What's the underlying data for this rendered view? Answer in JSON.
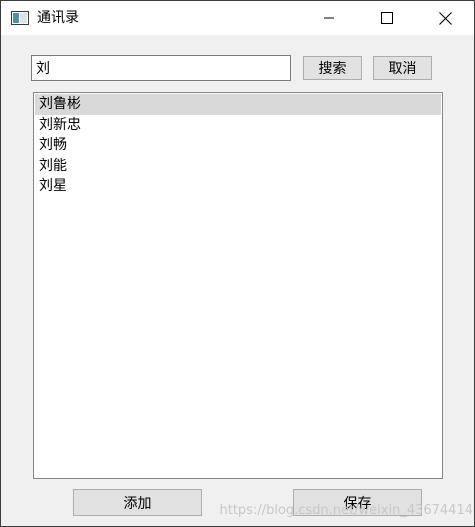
{
  "window": {
    "title": "通讯录",
    "icons": {
      "app": "app-window-icon",
      "minimize": "minimize-icon",
      "maximize": "maximize-icon",
      "close": "close-icon"
    }
  },
  "search": {
    "value": "刘",
    "search_label": "搜索",
    "cancel_label": "取消"
  },
  "contacts": {
    "selected_index": 0,
    "items": [
      "刘鲁彬",
      "刘新忠",
      "刘畅",
      "刘能",
      "刘星"
    ]
  },
  "footer": {
    "add_label": "添加",
    "save_label": "保存"
  },
  "watermark": "https://blog.csdn.net/weixin_43674414",
  "colors": {
    "selection": "#d9d9d9",
    "button_face": "#e1e1e1",
    "window_bg": "#f0f0f0"
  }
}
